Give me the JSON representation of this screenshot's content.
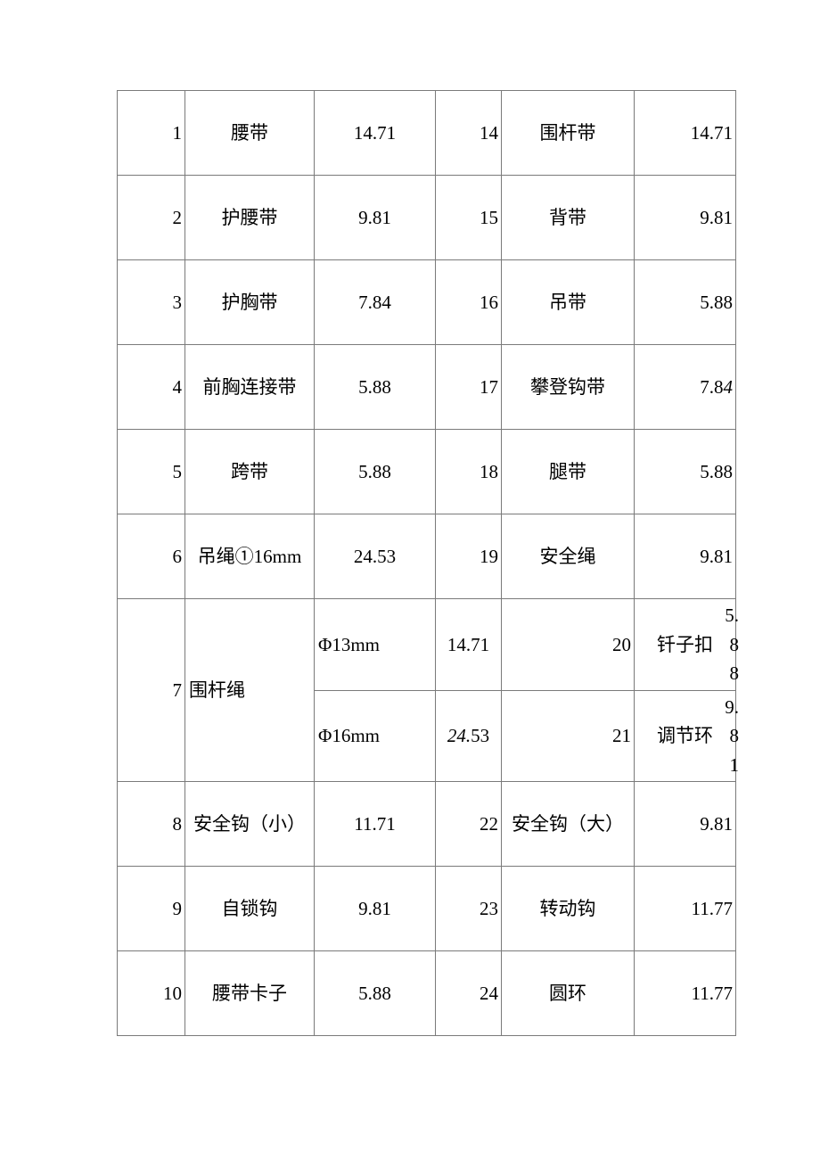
{
  "document": {
    "type": "table",
    "table": {
      "columns": 6,
      "rows": [
        {
          "no": "1",
          "name": "腰带",
          "value": "14.71",
          "no2": "14",
          "name2": "围杆带",
          "value2": "14.71"
        },
        {
          "no": "2",
          "name": "护腰带",
          "value": "9.81",
          "no2": "15",
          "name2": "背带",
          "value2": "9.81"
        },
        {
          "no": "3",
          "name": "护胸带",
          "value": "7.84",
          "no2": "16",
          "name2": "吊带",
          "value2": "5.88"
        },
        {
          "no": "4",
          "name": "前胸连接带",
          "value": "5.88",
          "no2": "17",
          "name2": "攀登钩带",
          "value2": "7.8",
          "value2_italic": "4"
        },
        {
          "no": "5",
          "name": "跨带",
          "value": "5.88",
          "no2": "18",
          "name2": "腿带",
          "value2": "5.88"
        },
        {
          "no": "6",
          "name": "吊绳①16mm",
          "value": "24.53",
          "no2": "19",
          "name2": "安全绳",
          "value2": "9.81"
        }
      ],
      "split_row": {
        "no": "7",
        "group_label": "围杆绳",
        "sub_rows": [
          {
            "spec": "Φ13mm",
            "value": "14.71",
            "no2": "20",
            "name2": "钎子扣",
            "value2": "5.88"
          },
          {
            "spec": "Φ16mm",
            "value_italic": "24.",
            "value_rest": "53",
            "no2": "21",
            "name2": "调节环",
            "value2": "9.81"
          }
        ]
      },
      "rows_tail": [
        {
          "no": "8",
          "name": "安全钩（小）",
          "value": "11.71",
          "no2": "22",
          "name2": "安全钩（大）",
          "value2": "9.81"
        },
        {
          "no": "9",
          "name": "自锁钩",
          "value": "9.81",
          "no2": "23",
          "name2": "转动钩",
          "value2": "11.77"
        },
        {
          "no": "10",
          "name": "腰带卡子",
          "value": "5.88",
          "no2": "24",
          "name2": "圆环",
          "value2": "11.77"
        }
      ]
    }
  }
}
